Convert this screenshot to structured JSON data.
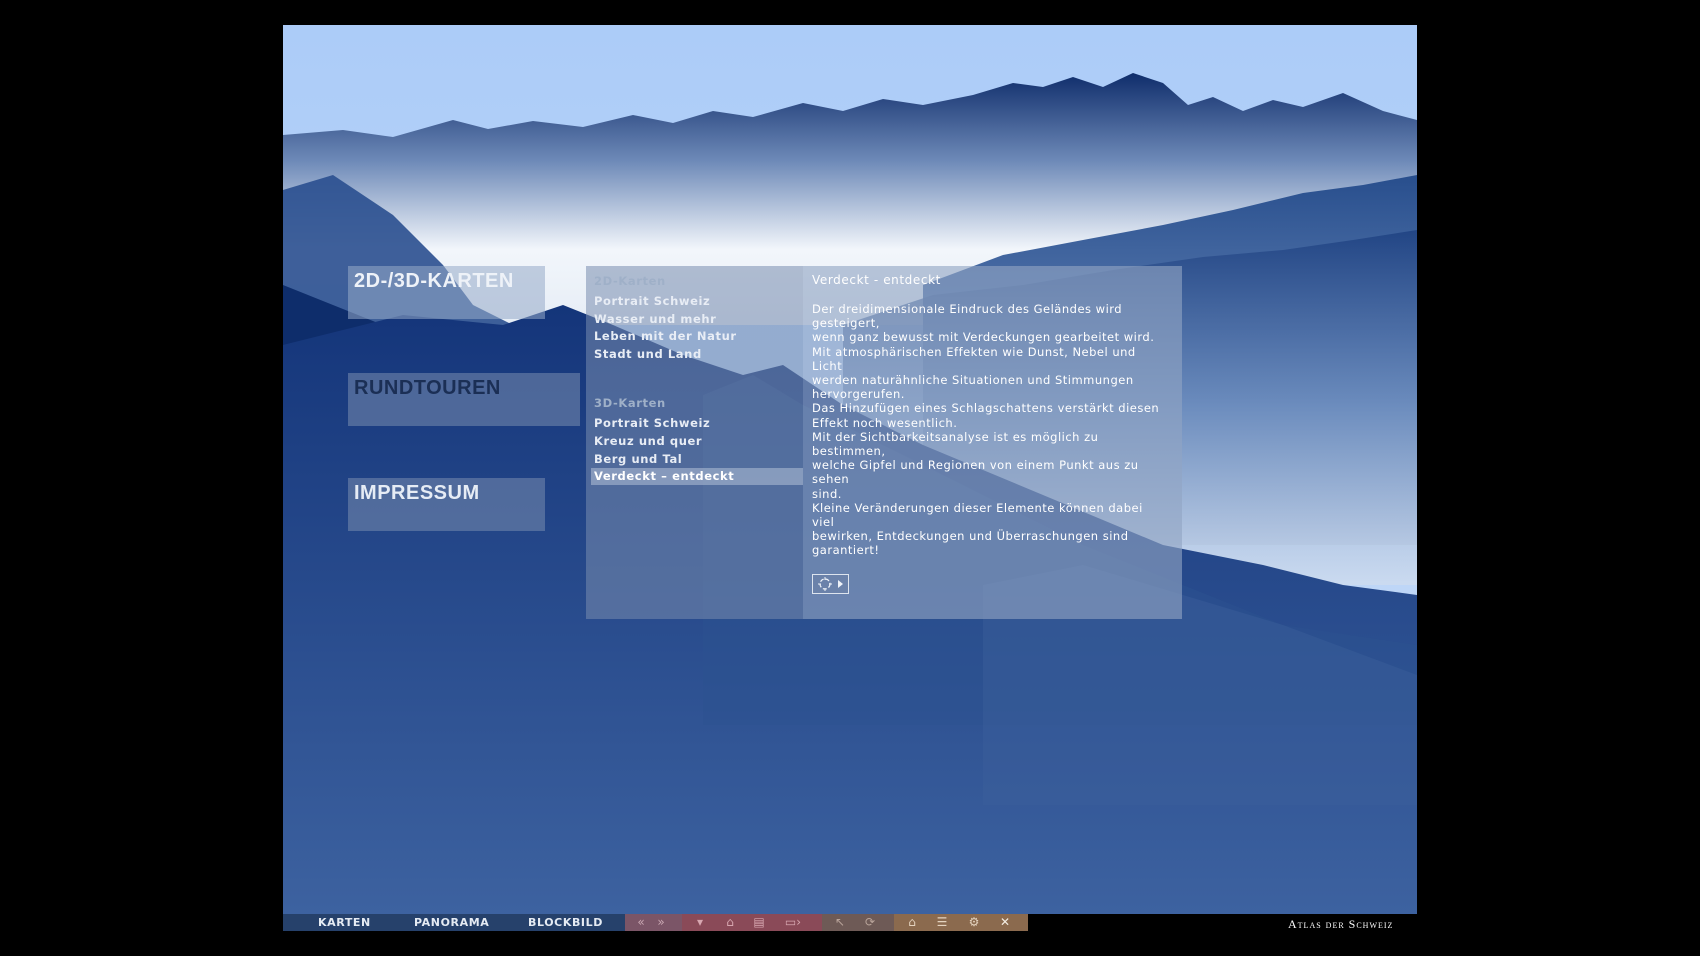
{
  "left_nav": {
    "items": [
      {
        "label": "2D-/3D-KARTEN",
        "active": true
      },
      {
        "label": "RUNDTOUREN",
        "active": false
      },
      {
        "label": "IMPRESSUM",
        "active": false
      }
    ]
  },
  "menu": {
    "section_2d": "2D-Karten",
    "items_2d": [
      "Portrait Schweiz",
      "Wasser und mehr",
      "Leben mit der Natur",
      "Stadt und Land"
    ],
    "section_3d": "3D-Karten",
    "items_3d": [
      "Portrait Schweiz",
      "Kreuz und quer",
      "Berg und Tal",
      "Verdeckt – entdeckt"
    ],
    "selected": "Verdeckt – entdeckt"
  },
  "content": {
    "title": "Verdeckt - entdeckt",
    "lines": [
      "Der dreidimensionale Eindruck des Geländes wird gesteigert,",
      "wenn ganz bewusst mit Verdeckungen gearbeitet wird.",
      "Mit atmosphärischen Effekten wie Dunst, Nebel und Licht",
      "werden naturähnliche Situationen und Stimmungen",
      "hervorgerufen.",
      "Das Hinzufügen eines Schlagschattens verstärkt diesen",
      "Effekt noch wesentlich.",
      "Mit der Sichtbarkeitsanalyse ist es möglich zu bestimmen,",
      "welche Gipfel und Regionen von einem Punkt aus zu sehen",
      "sind.",
      "Kleine Veränderungen dieser Elemente können dabei viel",
      "bewirken, Entdeckungen und Überraschungen sind",
      "garantiert!"
    ],
    "play_icon": "rotate-play-icon"
  },
  "toolbar": {
    "tabs": [
      "KARTEN",
      "PANORAMA",
      "BLOCKBILD"
    ],
    "nav_icons": [
      "«",
      "»"
    ],
    "tool_icons": [
      "legend-icon",
      "lock-icon",
      "print-icon",
      "export-icon",
      "pointer-icon",
      "rotate-icon",
      "home-icon",
      "list-icon",
      "settings-icon",
      "close-icon"
    ],
    "brand": "Atlas der Schweiz"
  },
  "colors": {
    "sky_top": "#aacbf7",
    "deep_blue": "#0c2a66",
    "toolbar_nav": "#26416b",
    "toolbar_mid": "#7a4f5e",
    "toolbar_right": "#8b6e55"
  }
}
